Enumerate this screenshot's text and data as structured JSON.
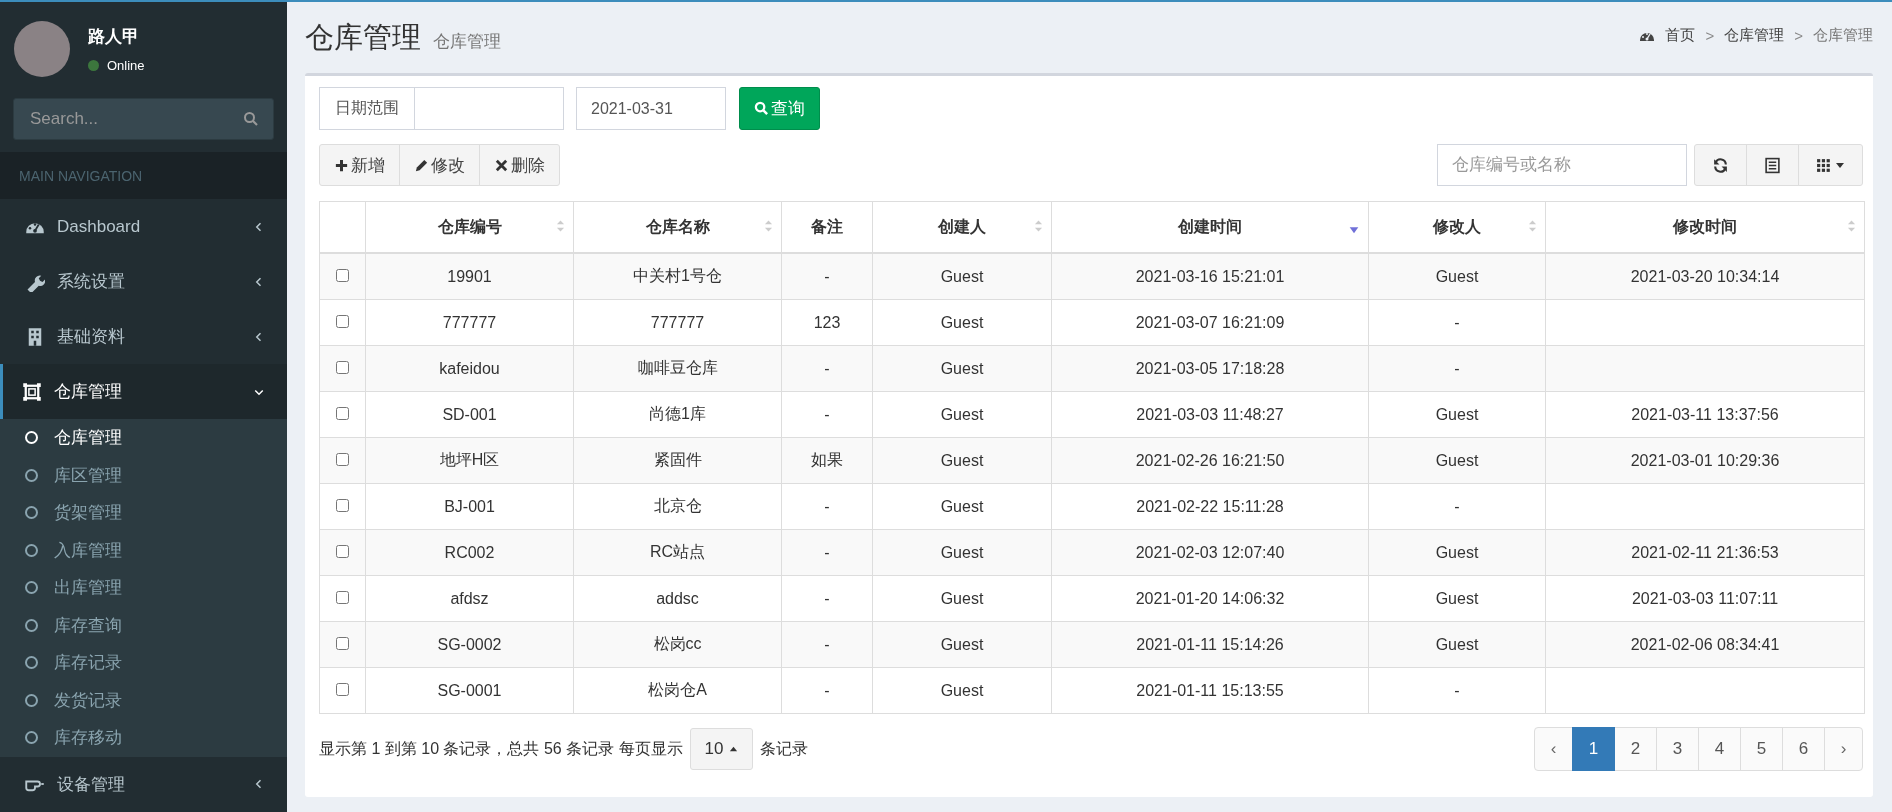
{
  "user": {
    "name": "路人甲",
    "status": "Online",
    "online": true
  },
  "sidebar": {
    "search": {
      "placeholder": "Search..."
    },
    "section": "MAIN NAVIGATION",
    "items": [
      {
        "label": "Dashboard",
        "expanded": false,
        "selected": false
      },
      {
        "label": "系统设置",
        "expanded": false,
        "selected": false
      },
      {
        "label": "基础资料",
        "expanded": false,
        "selected": false
      },
      {
        "label": "仓库管理",
        "expanded": true,
        "selected": true,
        "children": [
          {
            "label": "仓库管理",
            "selected": true
          },
          {
            "label": "库区管理",
            "selected": false
          },
          {
            "label": "货架管理",
            "selected": false
          },
          {
            "label": "入库管理",
            "selected": false
          },
          {
            "label": "出库管理",
            "selected": false
          },
          {
            "label": "库存查询",
            "selected": false
          },
          {
            "label": "库存记录",
            "selected": false
          },
          {
            "label": "发货记录",
            "selected": false
          },
          {
            "label": "库存移动",
            "selected": false
          }
        ]
      },
      {
        "label": "设备管理",
        "expanded": false,
        "selected": false
      }
    ]
  },
  "page": {
    "title": "仓库管理",
    "subtitle": "仓库管理"
  },
  "breadcrumb": [
    {
      "kind": "link",
      "text": "首页"
    },
    {
      "kind": "sep",
      "text": ">"
    },
    {
      "kind": "link",
      "text": "仓库管理"
    },
    {
      "kind": "sep",
      "text": ">"
    },
    {
      "kind": "current",
      "text": "仓库管理"
    }
  ],
  "filter": {
    "date_label": "日期范围",
    "date_to": "2021-03-31",
    "query_button": "查询"
  },
  "toolbar": {
    "buttons": [
      "新增",
      "修改",
      "删除"
    ],
    "search": {
      "placeholder": "仓库编号或名称"
    }
  },
  "table": {
    "columns": [
      {
        "label": "仓库编号",
        "sortable": true,
        "sorted_descending": false
      },
      {
        "label": "仓库名称",
        "sortable": true,
        "sorted_descending": false
      },
      {
        "label": "备注",
        "sortable": false,
        "sorted_descending": false
      },
      {
        "label": "创建人",
        "sortable": true,
        "sorted_descending": false
      },
      {
        "label": "创建时间",
        "sortable": true,
        "sorted_descending": true
      },
      {
        "label": "修改人",
        "sortable": true,
        "sorted_descending": false
      },
      {
        "label": "修改时间",
        "sortable": true,
        "sorted_descending": false
      }
    ],
    "rows": [
      {
        "checked": false,
        "cells": [
          "19901",
          "中关村1号仓",
          "-",
          "Guest",
          "2021-03-16 15:21:01",
          "Guest",
          "2021-03-20 10:34:14"
        ]
      },
      {
        "checked": false,
        "cells": [
          "777777",
          "777777",
          "123",
          "Guest",
          "2021-03-07 16:21:09",
          "-",
          ""
        ]
      },
      {
        "checked": false,
        "cells": [
          "kafeidou",
          "咖啡豆仓库",
          "-",
          "Guest",
          "2021-03-05 17:18:28",
          "-",
          ""
        ]
      },
      {
        "checked": false,
        "cells": [
          "SD-001",
          "尚德1库",
          "-",
          "Guest",
          "2021-03-03 11:48:27",
          "Guest",
          "2021-03-11 13:37:56"
        ]
      },
      {
        "checked": false,
        "cells": [
          "地坪H区",
          "紧固件",
          "如果",
          "Guest",
          "2021-02-26 16:21:50",
          "Guest",
          "2021-03-01 10:29:36"
        ]
      },
      {
        "checked": false,
        "cells": [
          "BJ-001",
          "北京仓",
          "-",
          "Guest",
          "2021-02-22 15:11:28",
          "-",
          ""
        ]
      },
      {
        "checked": false,
        "cells": [
          "RC002",
          "RC站点",
          "-",
          "Guest",
          "2021-02-03 12:07:40",
          "Guest",
          "2021-02-11 21:36:53"
        ]
      },
      {
        "checked": false,
        "cells": [
          "afdsz",
          "addsc",
          "-",
          "Guest",
          "2021-01-20 14:06:32",
          "Guest",
          "2021-03-03 11:07:11"
        ]
      },
      {
        "checked": false,
        "cells": [
          "SG-0002",
          "松岗cc",
          "-",
          "Guest",
          "2021-01-11 15:14:26",
          "Guest",
          "2021-02-06 08:34:41"
        ]
      },
      {
        "checked": false,
        "cells": [
          "SG-0001",
          "松岗仓A",
          "-",
          "Guest",
          "2021-01-11 15:13:55",
          "-",
          ""
        ]
      }
    ]
  },
  "pagination": {
    "summary": "显示第 1 到第 10 条记录，总共 56 条记录 每页显示",
    "page_size": "10",
    "suffix": "条记录",
    "prev": "‹",
    "next": "›",
    "pages": [
      {
        "label": "1",
        "selected": true
      },
      {
        "label": "2",
        "selected": false
      },
      {
        "label": "3",
        "selected": false
      },
      {
        "label": "4",
        "selected": false
      },
      {
        "label": "5",
        "selected": false
      },
      {
        "label": "6",
        "selected": false
      }
    ]
  }
}
